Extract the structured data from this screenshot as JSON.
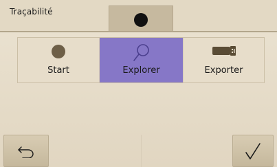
{
  "header": {
    "title": "Traçabilité",
    "record_icon": "record-dot-icon"
  },
  "tabs": [
    {
      "label": "Start",
      "icon": "start-circle-icon",
      "selected": false
    },
    {
      "label": "Explorer",
      "icon": "search-icon",
      "selected": true
    },
    {
      "label": "Exporter",
      "icon": "usb-drive-icon",
      "selected": false
    }
  ],
  "footer": {
    "back_icon": "undo-arrow-icon",
    "confirm_icon": "checkmark-icon"
  },
  "colors": {
    "background": "#e8dfcd",
    "selected_tab": "#8677c7",
    "button_face": "#cfc2a7",
    "icon_dark": "#1a1a1a"
  }
}
